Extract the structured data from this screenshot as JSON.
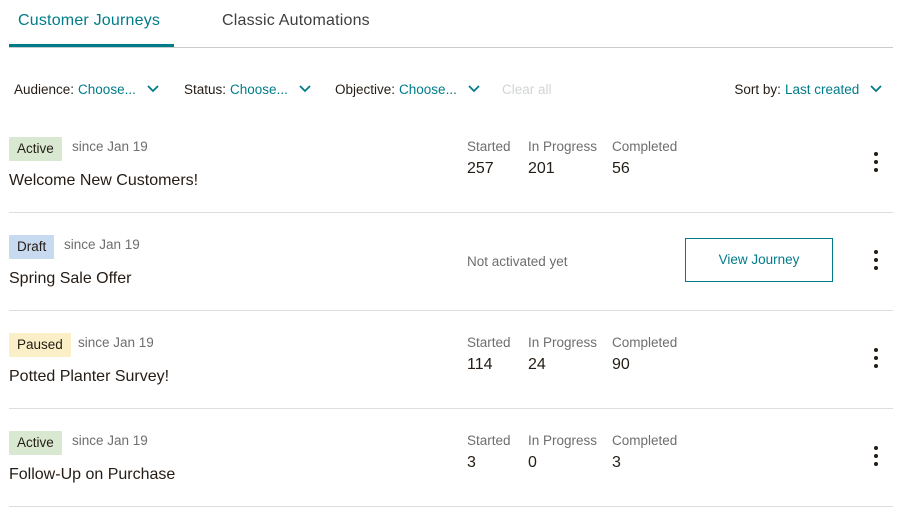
{
  "tabs": [
    {
      "label": "Customer Journeys",
      "active": true
    },
    {
      "label": "Classic Automations",
      "active": false
    }
  ],
  "filters": {
    "audience": {
      "label": "Audience:",
      "value": "Choose..."
    },
    "status": {
      "label": "Status:",
      "value": "Choose..."
    },
    "objective": {
      "label": "Objective:",
      "value": "Choose..."
    },
    "clear_all": "Clear all",
    "sort": {
      "label": "Sort by:",
      "value": "Last created"
    }
  },
  "icons": {
    "chevron": "chevron-down-icon",
    "more": "more-vertical-icon"
  },
  "colors": {
    "accent": "#007c89",
    "badge_active": "#d9e9d1",
    "badge_draft": "#c8daf0",
    "badge_paused": "#fbefc8"
  },
  "stat_labels": {
    "started": "Started",
    "in_progress": "In Progress",
    "completed": "Completed"
  },
  "journeys": [
    {
      "status": "Active",
      "since": "since Jan 19",
      "title": "Welcome New Customers!",
      "started": "257",
      "in_progress": "201",
      "completed": "56"
    },
    {
      "status": "Draft",
      "since": "since Jan 19",
      "title": "Spring Sale Offer",
      "note": "Not activated yet",
      "button": "View Journey"
    },
    {
      "status": "Paused",
      "since": "since Jan 19",
      "title": "Potted Planter Survey!",
      "started": "114",
      "in_progress": "24",
      "completed": "90"
    },
    {
      "status": "Active",
      "since": "since Jan 19",
      "title": "Follow-Up on Purchase",
      "started": "3",
      "in_progress": "0",
      "completed": "3"
    }
  ]
}
